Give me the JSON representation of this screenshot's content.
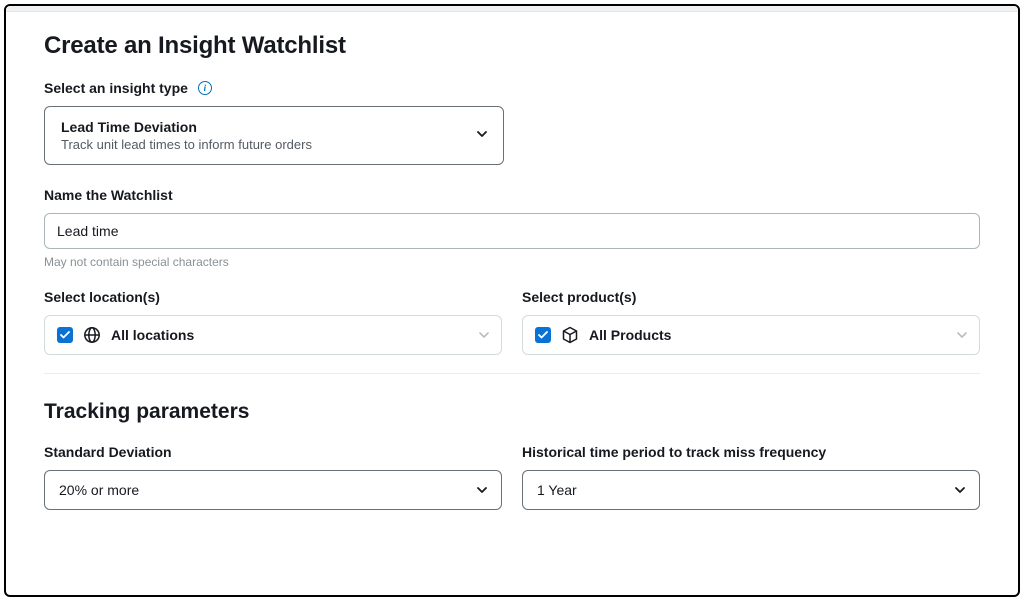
{
  "page": {
    "title": "Create an Insight Watchlist"
  },
  "insight_type": {
    "label": "Select an insight type",
    "selected_title": "Lead Time Deviation",
    "selected_desc": "Track unit lead times to inform future orders"
  },
  "watchlist_name": {
    "label": "Name the Watchlist",
    "value": "Lead time",
    "helper": "May not contain special characters"
  },
  "locations": {
    "label": "Select location(s)",
    "selected": "All locations"
  },
  "products": {
    "label": "Select product(s)",
    "selected": "All Products"
  },
  "tracking": {
    "title": "Tracking parameters",
    "std_dev": {
      "label": "Standard Deviation",
      "value": "20% or more"
    },
    "time_period": {
      "label": "Historical time period to track miss frequency",
      "value": "1 Year"
    }
  }
}
